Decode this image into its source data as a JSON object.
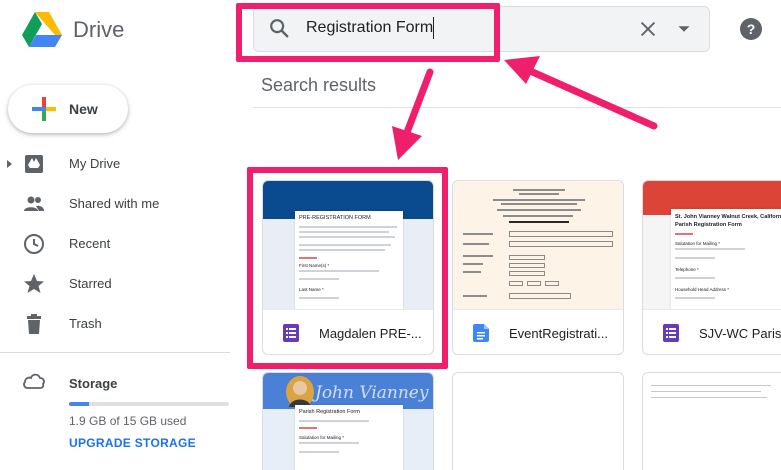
{
  "app": {
    "name": "Drive"
  },
  "search": {
    "query": "Registration Form"
  },
  "sidebar": {
    "new_label": "New",
    "items": [
      {
        "label": "My Drive",
        "icon": "my-drive-icon"
      },
      {
        "label": "Shared with me",
        "icon": "shared-people-icon"
      },
      {
        "label": "Recent",
        "icon": "clock-icon"
      },
      {
        "label": "Starred",
        "icon": "star-icon"
      },
      {
        "label": "Trash",
        "icon": "trash-icon"
      }
    ],
    "storage": {
      "title": "Storage",
      "used_text": "1.9 GB of 15 GB used",
      "used_fraction": 0.127,
      "upgrade_label": "UPGRADE STORAGE"
    }
  },
  "main": {
    "section_title": "Search results",
    "files": [
      {
        "name": "Magdalen PRE-...",
        "type": "google-form",
        "thumb": {
          "title": "PRE-REGISTRATION FORM",
          "q1": "First Name(s) *",
          "q2": "Last Name *"
        }
      },
      {
        "name": "EventRegistrati...",
        "type": "google-doc"
      },
      {
        "name": "SJV-WC Parish",
        "type": "google-form",
        "thumb": {
          "title": "St. John Vianney Walnut Creek, California Parish Registration Form",
          "q1": "Salutation for Mailing *",
          "q2": "Telephone *",
          "q3": "Household Head Address *"
        }
      },
      {
        "name": "",
        "type": "google-form",
        "thumb": {
          "title": "Parish Registration Form",
          "q1": "Salutation for Mailing *",
          "banner": "John Vianney"
        }
      },
      {
        "name": "",
        "type": "blank"
      },
      {
        "name": "",
        "type": "blank"
      }
    ]
  },
  "colors": {
    "highlight": "#f01f6c",
    "accent_blue": "#1a73e8",
    "form_purple": "#673ab7",
    "doc_blue": "#4285f4"
  }
}
